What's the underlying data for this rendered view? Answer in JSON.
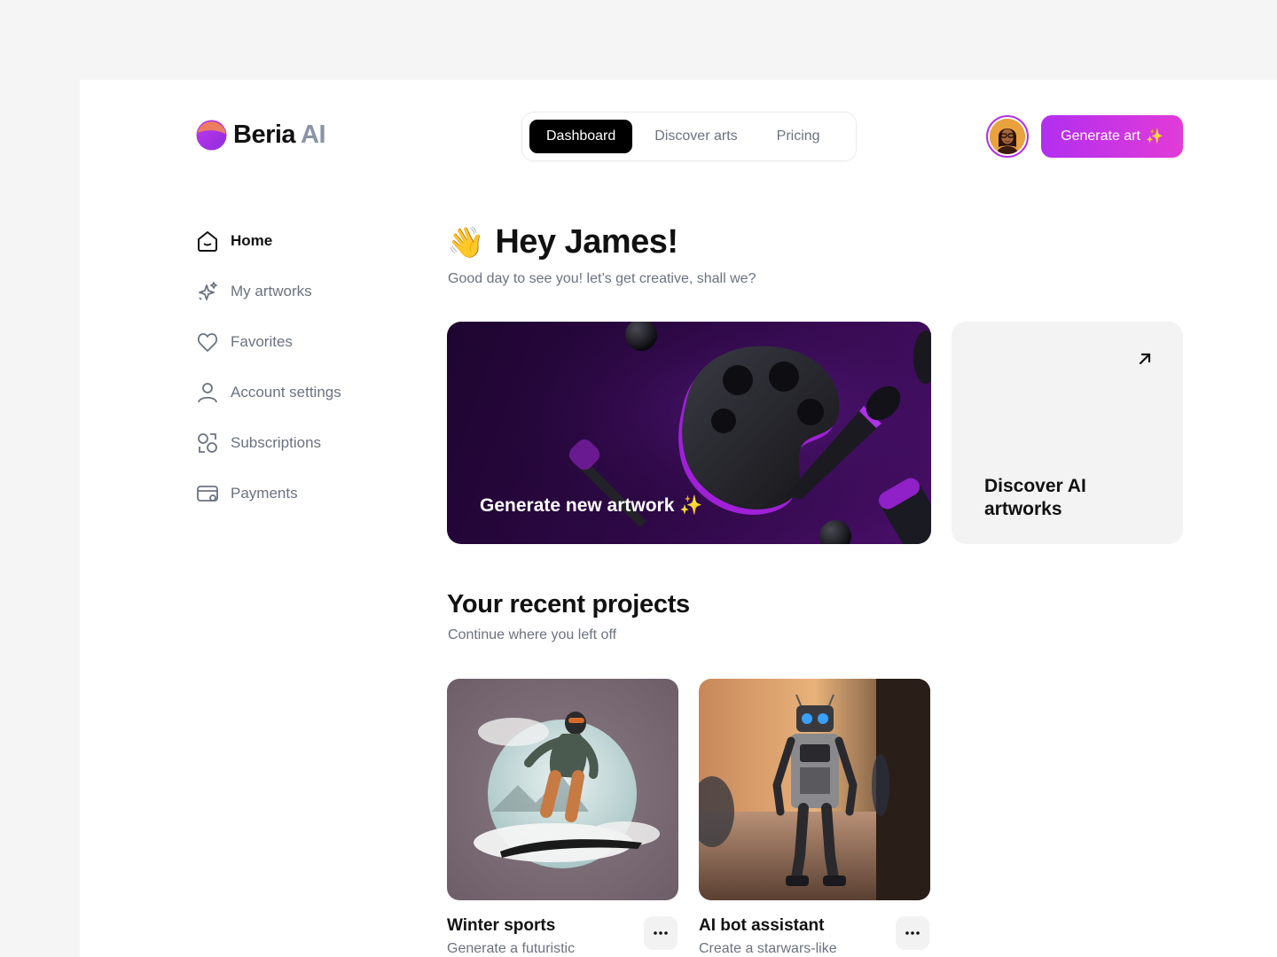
{
  "brand": {
    "name": "Beria",
    "suffix": "AI"
  },
  "nav": {
    "items": [
      {
        "label": "Dashboard",
        "active": true
      },
      {
        "label": "Discover arts",
        "active": false
      },
      {
        "label": "Pricing",
        "active": false
      }
    ]
  },
  "header": {
    "generate_label": "Generate art",
    "generate_emoji": "✨"
  },
  "sidebar": {
    "items": [
      {
        "label": "Home",
        "icon": "home-icon",
        "active": true
      },
      {
        "label": "My artworks",
        "icon": "sparkle-icon",
        "active": false
      },
      {
        "label": "Favorites",
        "icon": "heart-icon",
        "active": false
      },
      {
        "label": "Account settings",
        "icon": "user-icon",
        "active": false
      },
      {
        "label": "Subscriptions",
        "icon": "subscription-icon",
        "active": false
      },
      {
        "label": "Payments",
        "icon": "card-icon",
        "active": false
      }
    ]
  },
  "main": {
    "wave": "👋",
    "greeting": "Hey James!",
    "subtitle": "Good day to see you! let’s get creative, shall we?",
    "hero": {
      "title": "Generate new artwork",
      "emoji": "✨"
    },
    "discover": {
      "title": "Discover AI artworks"
    },
    "recent": {
      "title": "Your recent projects",
      "subtitle": "Continue where you left off",
      "projects": [
        {
          "title": "Winter sports",
          "desc": "Generate a futuristic"
        },
        {
          "title": "AI bot assistant",
          "desc": "Create a starwars-like"
        }
      ]
    }
  },
  "colors": {
    "accent": "#b12ff0",
    "accent2": "#e23bd8",
    "hero_bg": "#2d0845"
  }
}
